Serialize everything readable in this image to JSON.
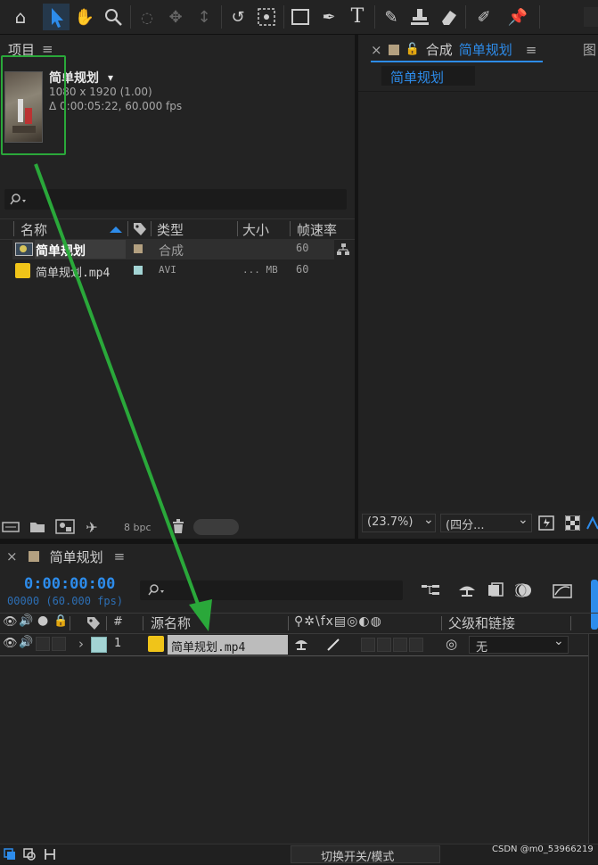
{
  "toolbar": {
    "icons": [
      "home-icon",
      "selection-tool-icon",
      "hand-tool-icon",
      "zoom-tool-icon",
      "orbit-camera-icon",
      "pan-camera-icon",
      "dolly-camera-icon",
      "rotation-tool-icon",
      "pan-behind-icon",
      "rectangle-tool-icon",
      "pen-tool-icon",
      "text-tool-icon",
      "brush-tool-icon",
      "clone-stamp-icon",
      "eraser-tool-icon",
      "roto-brush-icon",
      "puppet-pin-icon"
    ]
  },
  "project_panel": {
    "title": "项目",
    "menu_glyph": "≡",
    "footage_name": "简单规划",
    "dropdown_glyph": "▾",
    "footage_res": "1080 x 1920 (1.00)",
    "footage_duration": "Δ 0:00:05:22, 60.000 fps",
    "columns": {
      "name": "名称",
      "type": "类型",
      "size": "大小",
      "fps": "帧速率"
    },
    "rows": [
      {
        "name": "简单规划",
        "type": "合成",
        "size": "",
        "fps": "60",
        "label_color": "#b3a080"
      },
      {
        "name": "简单规划.mp4",
        "type": "AVI",
        "size": "... MB",
        "fps": "60",
        "label_color": "#a3d4d4"
      }
    ],
    "bpc": "8 bpc"
  },
  "comp_panel": {
    "close_glyph": "×",
    "lock_glyph": "🔓",
    "title_prefix": "合成",
    "title_name": "简单规划",
    "menu_glyph": "≡",
    "overflow_glyph": "图",
    "tab_label": "简单规划",
    "zoom": "(23.7%)",
    "resolution": "(四分...",
    "chevron_glyph": "⌄"
  },
  "timeline": {
    "close_glyph": "×",
    "title": "简单规划",
    "menu_glyph": "≡",
    "timecode": "0:00:00:00",
    "frames": "00000 (60.000 fps)",
    "columns": {
      "num": "#",
      "source": "源名称",
      "switches": "⚲✲\\fx▤◎◐◍",
      "parent": "父级和链接"
    },
    "layer": {
      "index": "1",
      "chevron": "›",
      "name": "简单规划.mp4",
      "parent_value": "无",
      "label_color": "#a3d4d4"
    },
    "mode_toggle": "切换开关/模式"
  },
  "watermark": "CSDN @m0_53966219",
  "colors": {
    "annotation": "#2aa83a",
    "accent": "#2d8ceb"
  }
}
